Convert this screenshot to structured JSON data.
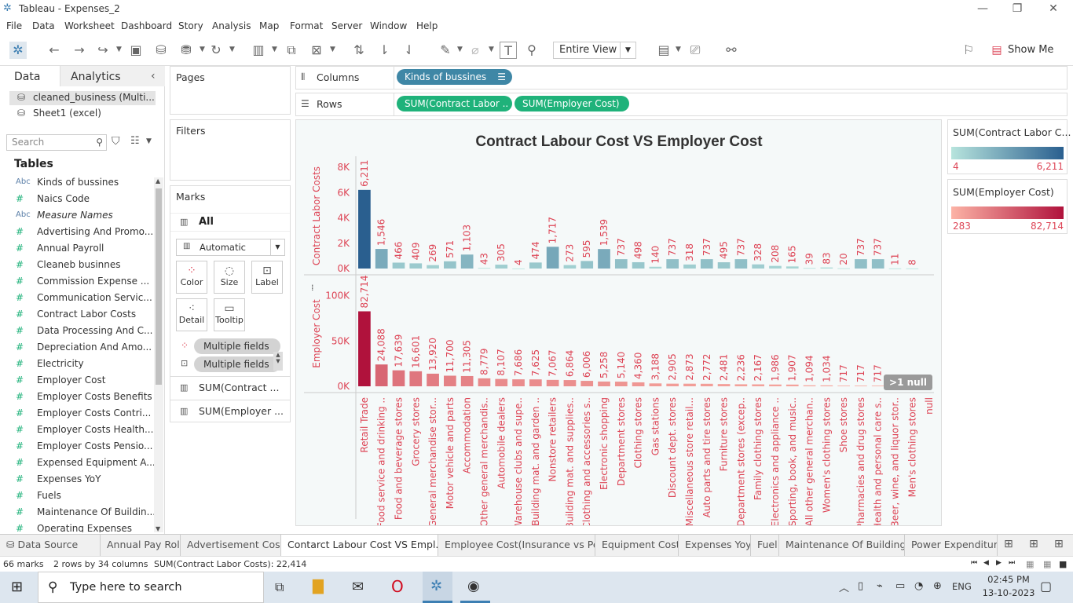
{
  "window": {
    "title": "Tableau - Expenses_2"
  },
  "menu": [
    "File",
    "Data",
    "Worksheet",
    "Dashboard",
    "Story",
    "Analysis",
    "Map",
    "Format",
    "Server",
    "Window",
    "Help"
  ],
  "toolbar": {
    "fit_mode": "Entire View",
    "show_me": "Show Me"
  },
  "left_panel": {
    "tab_data": "Data",
    "tab_analytics": "Analytics",
    "datasources": [
      "cleaned_business (Multi...",
      "Sheet1 (excel)"
    ],
    "search_placeholder": "Search",
    "tables_label": "Tables",
    "fields": [
      {
        "type": "Abc",
        "name": "Kinds of bussines",
        "italic": false
      },
      {
        "type": "#",
        "name": "Naics Code",
        "italic": false
      },
      {
        "type": "Abc",
        "name": "Measure Names",
        "italic": true
      },
      {
        "type": "#",
        "name": "Advertising And Promo...",
        "italic": false
      },
      {
        "type": "#",
        "name": "Annual Payroll",
        "italic": false
      },
      {
        "type": "#",
        "name": "Cleaneb businnes",
        "italic": false
      },
      {
        "type": "#",
        "name": "Commission Expense ...",
        "italic": false
      },
      {
        "type": "#",
        "name": "Communication Servic...",
        "italic": false
      },
      {
        "type": "#",
        "name": "Contract Labor Costs",
        "italic": false
      },
      {
        "type": "#",
        "name": "Data Processing And C...",
        "italic": false
      },
      {
        "type": "#",
        "name": "Depreciation And Amo...",
        "italic": false
      },
      {
        "type": "#",
        "name": "Electricity",
        "italic": false
      },
      {
        "type": "#",
        "name": "Employer Cost",
        "italic": false
      },
      {
        "type": "#",
        "name": "Employer Costs Benefits",
        "italic": false
      },
      {
        "type": "#",
        "name": "Employer Costs Contri...",
        "italic": false
      },
      {
        "type": "#",
        "name": "Employer Costs Health...",
        "italic": false
      },
      {
        "type": "#",
        "name": "Employer Costs Pensio...",
        "italic": false
      },
      {
        "type": "#",
        "name": "Expensed Equipment A...",
        "italic": false
      },
      {
        "type": "#",
        "name": "Expenses YoY",
        "italic": false
      },
      {
        "type": "#",
        "name": "Fuels",
        "italic": false
      },
      {
        "type": "#",
        "name": "Maintenance Of Buildin...",
        "italic": false
      },
      {
        "type": "#",
        "name": "Operating Expenses",
        "italic": false
      }
    ]
  },
  "shelves": {
    "pages": "Pages",
    "filters": "Filters",
    "marks": "Marks",
    "marks_all": "All",
    "mark_type": "Automatic",
    "mark_buttons": [
      "Color",
      "Size",
      "Label",
      "Detail",
      "Tooltip"
    ],
    "multiple_fields_1": "Multiple fields",
    "multiple_fields_2": "Multiple fields",
    "measure_1": "SUM(Contract ...",
    "measure_2": "SUM(Employer ...",
    "columns_label": "Columns",
    "rows_label": "Rows",
    "columns_pill": "Kinds of bussines",
    "rows_pill_1": "SUM(Contract Labor ..",
    "rows_pill_2": "SUM(Employer Cost)"
  },
  "legends": [
    {
      "title": "SUM(Contract Labor C...",
      "min": "4",
      "max": "6,211",
      "color_low": "#b7e4dd",
      "color_high": "#2a5f8f"
    },
    {
      "title": "SUM(Employer Cost)",
      "min": "283",
      "max": "82,714",
      "color_low": "#fcb3a6",
      "color_high": "#b0123c"
    }
  ],
  "null_badge": ">1 null",
  "chart_data": [
    {
      "type": "bar",
      "title": "Contract Labour Cost VS Employer Cost",
      "ylabel": "Contract Labor Costs",
      "ylim": [
        0,
        8000
      ],
      "yticks": [
        "8K",
        "6K",
        "4K",
        "2K",
        "0K"
      ],
      "categories": [
        "Retail Trade",
        "Food service and drinking ..",
        "Food and beverage stores",
        "Grocery stores",
        "General merchandise stor...",
        "Motor vehicle and parts",
        "Accommodation",
        "Other general merchandis..",
        "Automobile dealers",
        "Warehouse clubs and supe..",
        "Building mat. and garden ..",
        "Nonstore retailers",
        "Building mat. and supplies..",
        "Clothing and accessories s..",
        "Electronic shopping",
        "Department stores",
        "Clothing stores",
        "Gas stations",
        "Discount dept. stores",
        "Miscellaneous store retail...",
        "Auto parts and tire stores",
        "Furniture stores",
        "Department stores (excep..",
        "Family clothing stores",
        "Electronics and appliance ..",
        "Sporting, book, and music..",
        "All other general merchan..",
        "Women's clothing stores",
        "Shoe stores",
        "Pharmacies and drug stores",
        "Health and personal care s..",
        "Beer, wine, and liquor stor..",
        "Men's clothing stores",
        "null"
      ],
      "values": [
        6211,
        1546,
        466,
        409,
        269,
        571,
        1103,
        43,
        305,
        4,
        474,
        1717,
        273,
        595,
        1539,
        737,
        498,
        140,
        737,
        318,
        737,
        495,
        737,
        328,
        208,
        165,
        39,
        83,
        20,
        737,
        737,
        11,
        8,
        null
      ],
      "labels": [
        "6,211",
        "1,546",
        "466",
        "409",
        "269",
        "571",
        "1,103",
        "43",
        "305",
        "4",
        "474",
        "1,717",
        "273",
        "595",
        "1,539",
        "737",
        "498",
        "140",
        "737",
        "318",
        "737",
        "495",
        "737",
        "328",
        "208",
        "165",
        "39",
        "83",
        "20",
        "737",
        "737",
        "11",
        "8",
        ""
      ]
    },
    {
      "type": "bar",
      "ylabel": "Employer Cost",
      "ylim": [
        0,
        110000
      ],
      "yticks": [
        "100K",
        "50K",
        "0K"
      ],
      "values": [
        82714,
        24088,
        17639,
        16601,
        13920,
        11700,
        11305,
        8779,
        8107,
        7686,
        7625,
        7067,
        6864,
        6006,
        5258,
        5140,
        4360,
        3188,
        2905,
        2873,
        2772,
        2481,
        2236,
        2167,
        1986,
        1907,
        1094,
        1034,
        717,
        717,
        717,
        283,
        null,
        null
      ],
      "labels": [
        "82,714",
        "24,088",
        "17,639",
        "16,601",
        "13,920",
        "11,700",
        "11,305",
        "8,779",
        "8,107",
        "7,686",
        "7,625",
        "7,067",
        "6,864",
        "6,006",
        "5,258",
        "5,140",
        "4,360",
        "3,188",
        "2,905",
        "2,873",
        "2,772",
        "2,481",
        "2,236",
        "2,167",
        "1,986",
        "1,907",
        "1,094",
        "1,034",
        "717",
        "717",
        "717",
        "",
        "",
        ""
      ]
    }
  ],
  "sheet_tabs": [
    "Data Source",
    "Annual Pay Roll",
    "Advertisement Cost",
    "Contarct Labour Cost VS Empl...",
    "Employee  Cost(Insurance vs Pe...",
    "Equipment Cost",
    "Expenses Yoy",
    "Fuel",
    "Maintenance Of Buildings",
    "Power Expenditure"
  ],
  "active_tab": 3,
  "status": {
    "marks": "66 marks",
    "dims": "2 rows by 34 columns",
    "sum": "SUM(Contract Labor Costs): 22,414"
  },
  "taskbar": {
    "search": "Type here to search",
    "lang": "ENG",
    "time": "02:45 PM",
    "date": "13-10-2023"
  }
}
